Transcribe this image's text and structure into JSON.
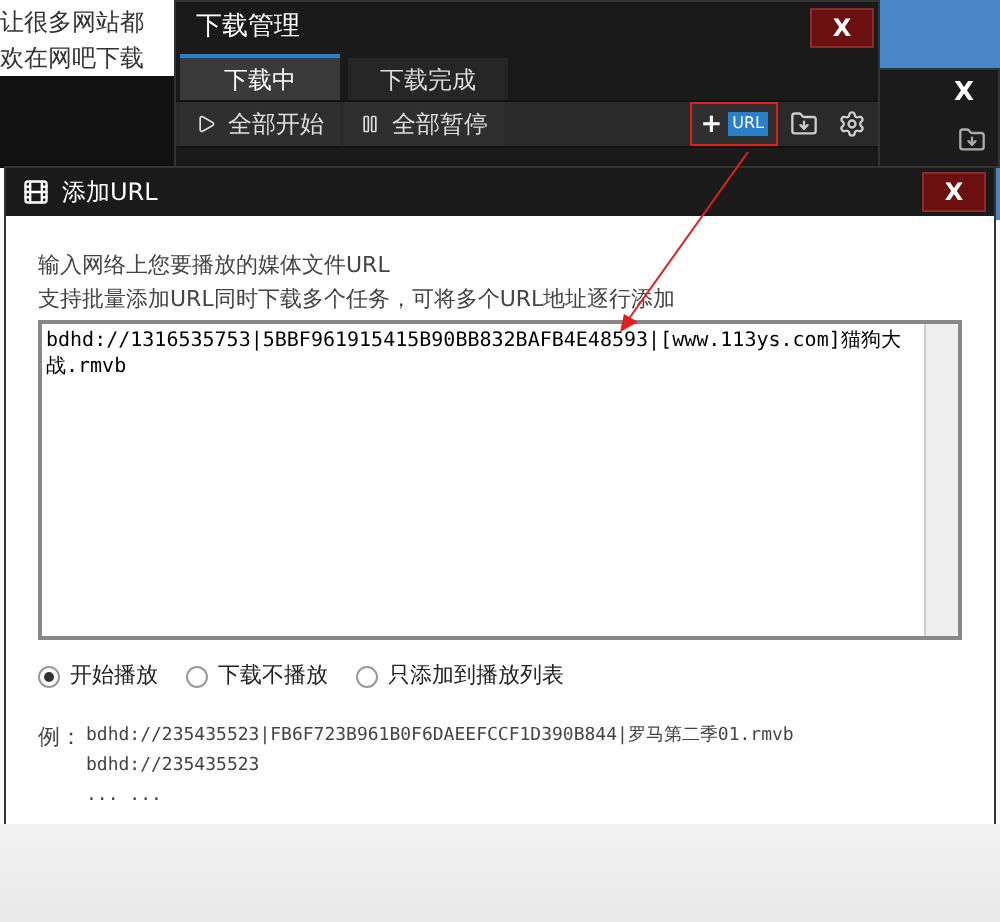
{
  "background_page": {
    "lines": [
      "让很多网站都",
      "欢在网吧下载"
    ]
  },
  "download_manager": {
    "title": "下载管理",
    "close": "X",
    "tabs": [
      {
        "label": "下载中",
        "selected": true
      },
      {
        "label": "下载完成",
        "selected": false
      }
    ],
    "toolbar": [
      "全部开始",
      "全部暂停"
    ],
    "url_plus": "+",
    "url_button": "URL"
  },
  "back_window": {
    "close": "X"
  },
  "dialog": {
    "title": "添加URL",
    "close": "X",
    "instructions": [
      "输入网络上您要播放的媒体文件URL",
      "支持批量添加URL同时下载多个任务，可将多个URL地址逐行添加"
    ],
    "url_value": "bdhd://1316535753|5BBF961915415B90BB832BAFB4E48593|[www.113ys.com]猫狗大战.rmvb",
    "options": [
      {
        "label": "开始播放",
        "selected": true
      },
      {
        "label": "下载不播放",
        "selected": false
      },
      {
        "label": "只添加到播放列表",
        "selected": false
      }
    ],
    "example_label": "例：",
    "examples": [
      "bdhd://235435523|FB6F723B961B0F6DAEEFCCF1D390B844|罗马第二季01.rmvb",
      "bdhd://235435523",
      "... ..."
    ]
  }
}
